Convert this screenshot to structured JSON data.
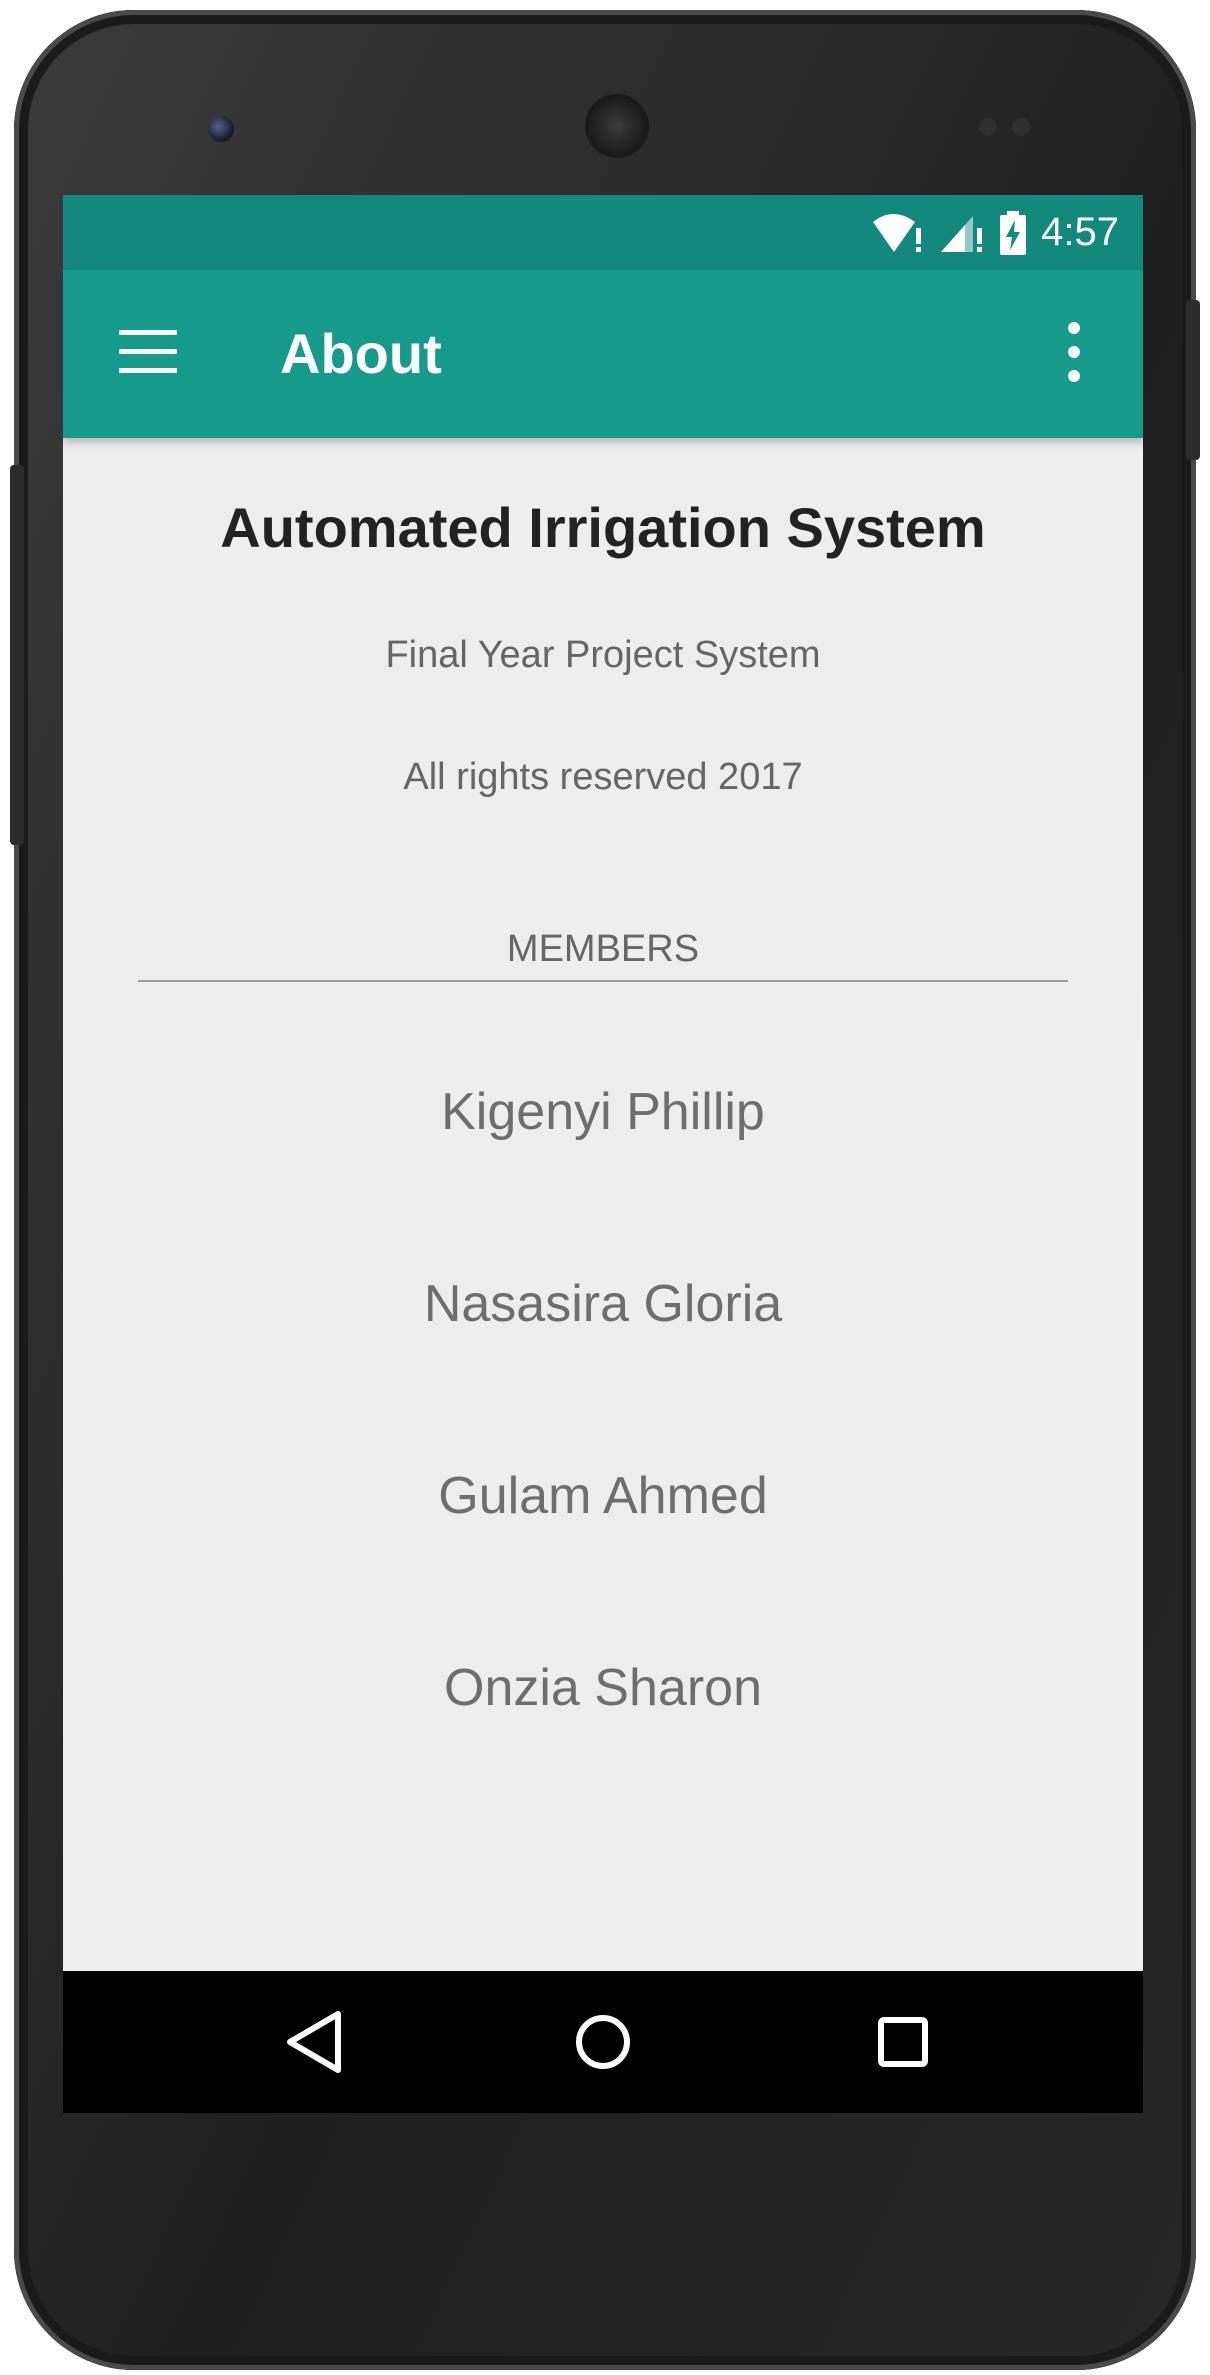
{
  "status_bar": {
    "time": "4:57",
    "icons": [
      "wifi-alert-icon",
      "signal-alert-icon",
      "battery-charging-icon"
    ]
  },
  "app_bar": {
    "title": "About",
    "nav_icon": "menu-icon",
    "action_icon": "overflow-menu-icon"
  },
  "about": {
    "app_name": "Automated Irrigation System",
    "subtitle": "Final Year Project System",
    "rights": "All rights reserved 2017",
    "members_label": "MEMBERS",
    "members": [
      "Kigenyi Phillip",
      "Nasasira Gloria",
      "Gulam Ahmed",
      "Onzia Sharon"
    ]
  },
  "nav_bar": {
    "buttons": [
      "back-icon",
      "home-icon",
      "recents-icon"
    ]
  },
  "colors": {
    "status_bar": "#12897c",
    "app_bar": "#159a8b",
    "background": "#eeeeee",
    "primary_text": "#222222",
    "secondary_text": "#666666"
  }
}
